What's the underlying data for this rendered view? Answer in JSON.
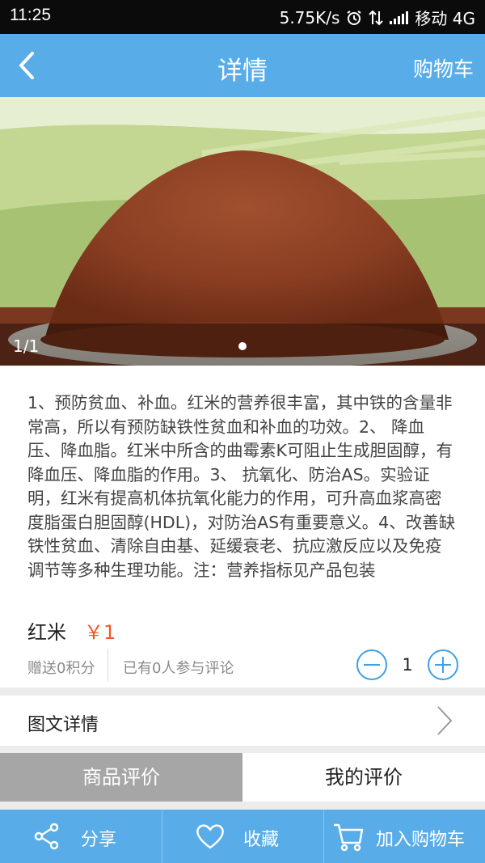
{
  "status_bar": {
    "time": "11:25",
    "network_speed": "5.75K/s",
    "carrier": "移动 4G"
  },
  "nav": {
    "title": "详情",
    "cart_label": "购物车"
  },
  "banner": {
    "counter": "1/1",
    "image_icon": "red-rice-bowl-photo"
  },
  "product": {
    "description": "1、预防贫血、补血。红米的营养很丰富，其中铁的含量非常高，所以有预防缺铁性贫血和补血的功效。2、 降血压、降血脂。红米中所含的曲霉素K可阻止生成胆固醇，有降血压、降血脂的作用。3、 抗氧化、防治AS。实验证明，红米有提高机体抗氧化能力的作用，可升高血浆高密度脂蛋白胆固醇(HDL)，对防治AS有重要意义。4、改善缺铁性贫血、清除自由基、延缓衰老、抗应激反应以及免疫调节等多种生理功能。注：营养指标见产品包装",
    "name": "红米",
    "price": "￥1",
    "points": "赠送0积分",
    "review_count": "已有0人参与评论",
    "quantity": "1"
  },
  "detail_row": {
    "label": "图文详情"
  },
  "tabs": [
    {
      "label": "商品评价",
      "active": true
    },
    {
      "label": "我的评价",
      "active": false
    }
  ],
  "bottom_bar": {
    "share": "分享",
    "favorite": "收藏",
    "add_to_cart": "加入购物车"
  },
  "colors": {
    "accent": "#58ace8",
    "price": "#f0582c",
    "tab_active": "#a7a6a7"
  }
}
